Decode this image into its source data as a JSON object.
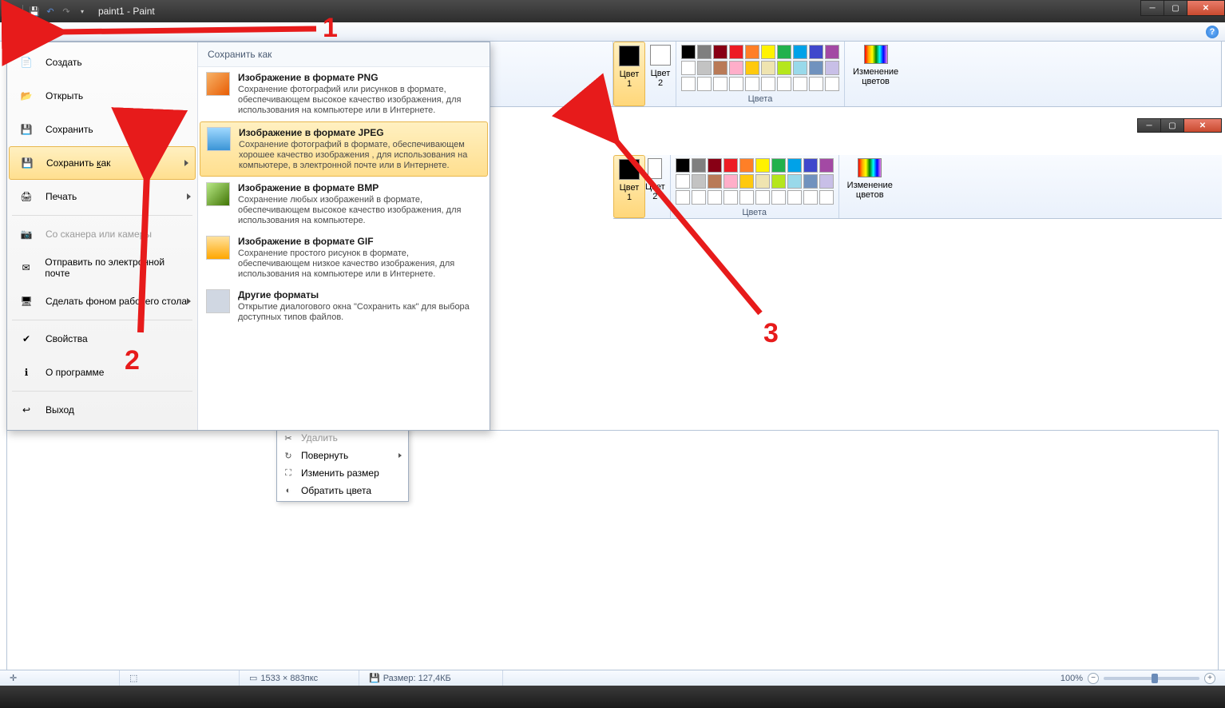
{
  "titlebar": {
    "title": "paint1 - Paint"
  },
  "annotations": {
    "n1": "1",
    "n2": "2",
    "n3": "3"
  },
  "ribbon": {
    "color1_label": "Цвет\n1",
    "color2_label": "Цвет\n2",
    "palette_label": "Цвета",
    "edit_colors_label": "Изменение\nцветов",
    "palette_row1": [
      "#000000",
      "#7f7f7f",
      "#880015",
      "#ed1c24",
      "#ff7f27",
      "#fff200",
      "#22b14c",
      "#00a2e8",
      "#3f48cc",
      "#a349a4"
    ],
    "palette_row2": [
      "#ffffff",
      "#c3c3c3",
      "#b97a57",
      "#ffaec9",
      "#ffc90e",
      "#efe4b0",
      "#b5e61d",
      "#99d9ea",
      "#7092be",
      "#c8bfe7"
    ],
    "palette_row3": [
      "#ffffff",
      "#ffffff",
      "#ffffff",
      "#ffffff",
      "#ffffff",
      "#ffffff",
      "#ffffff",
      "#ffffff",
      "#ffffff",
      "#ffffff"
    ]
  },
  "file_menu": {
    "items": [
      {
        "label": "Создать",
        "icon": "new"
      },
      {
        "label": "Открыть",
        "icon": "open"
      },
      {
        "label": "Сохранить",
        "icon": "save"
      },
      {
        "label": "Сохранить как",
        "icon": "saveas",
        "arrow": true,
        "selected": true,
        "underline": 0
      },
      {
        "label": "Печать",
        "icon": "print",
        "arrow": true
      },
      {
        "label": "Со сканера или камеры",
        "icon": "scanner",
        "disabled": true
      },
      {
        "label": "Отправить по электронной почте",
        "icon": "email"
      },
      {
        "label": "Сделать фоном рабочего стола",
        "icon": "desktop",
        "arrow": true
      },
      {
        "label": "Свойства",
        "icon": "properties"
      },
      {
        "label": "О программе",
        "icon": "about"
      },
      {
        "label": "Выход",
        "icon": "exit"
      }
    ],
    "submenu_header": "Сохранить как",
    "formats": [
      {
        "title": "Изображение в формате PNG",
        "desc": "Сохранение фотографий или рисунков в формате, обеспечивающем высокое качество изображения, для использования на компьютере или в Интернете.",
        "icon": "png"
      },
      {
        "title": "Изображение в формате JPEG",
        "desc": "Сохранение фотографий в формате, обеспечивающем хорошее качество изображения , для использования на компьютере, в электронной почте или в Интернете.",
        "icon": "jpeg",
        "selected": true
      },
      {
        "title": "Изображение в формате BMP",
        "desc": "Сохранение любых изображений в формате, обеспечивающем высокое качество изображения, для использования на компьютере.",
        "icon": "bmp"
      },
      {
        "title": "Изображение в формате GIF",
        "desc": "Сохранение простого рисунок в формате, обеспечивающем низкое качество изображения, для использования на компьютере или в Интернете.",
        "icon": "gif"
      },
      {
        "title": "Другие форматы",
        "desc": "Открытие диалогового окна \"Сохранить как\" для выбора доступных типов файлов.",
        "icon": "other"
      }
    ]
  },
  "context_menu": {
    "items": [
      {
        "label": "Удалить",
        "icon": "✂",
        "disabled": true
      },
      {
        "label": "Повернуть",
        "icon": "↻",
        "arrow": true
      },
      {
        "label": "Изменить размер",
        "icon": "⛶"
      },
      {
        "label": "Обратить цвета",
        "icon": "◐"
      }
    ]
  },
  "statusbar": {
    "cursor_icon": "+",
    "sel_icon": "⬚",
    "dims_label": "1533 × 883пкс",
    "size_label": "Размер: 127,4КБ",
    "zoom_label": "100%"
  }
}
